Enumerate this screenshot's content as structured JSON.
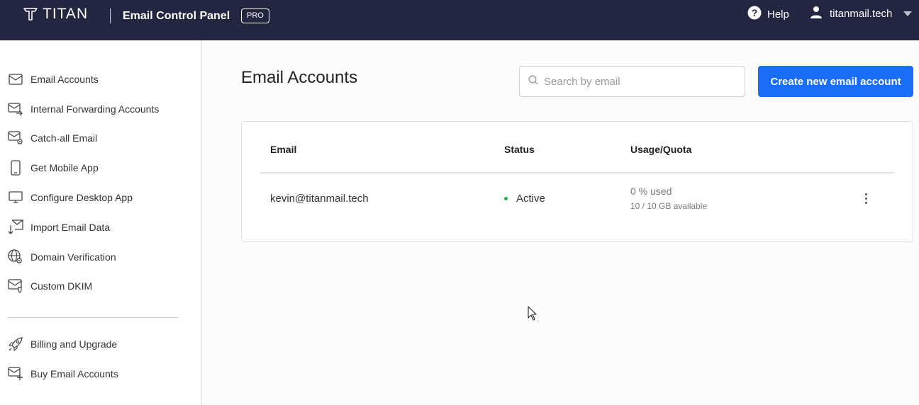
{
  "header": {
    "logo_text": "TITAN",
    "app_title": "Email Control Panel",
    "badge": "PRO",
    "help_label": "Help",
    "user_domain": "titanmail.tech"
  },
  "sidebar": {
    "items": [
      {
        "label": "Email Accounts",
        "icon": "envelope-icon"
      },
      {
        "label": "Internal Forwarding Accounts",
        "icon": "forward-mail-icon"
      },
      {
        "label": "Catch-all Email",
        "icon": "mail-gear-icon"
      },
      {
        "label": "Get Mobile App",
        "icon": "phone-icon"
      },
      {
        "label": "Configure Desktop App",
        "icon": "monitor-icon"
      },
      {
        "label": "Import Email Data",
        "icon": "import-icon"
      },
      {
        "label": "Domain Verification",
        "icon": "globe-gear-icon"
      },
      {
        "label": "Custom DKIM",
        "icon": "mail-shield-icon"
      }
    ],
    "secondary_items": [
      {
        "label": "Billing and Upgrade",
        "icon": "rocket-icon"
      },
      {
        "label": "Buy Email Accounts",
        "icon": "mail-plus-icon"
      }
    ]
  },
  "main": {
    "title": "Email Accounts",
    "search_placeholder": "Search by email",
    "create_button": "Create new email account",
    "table": {
      "columns": [
        "Email",
        "Status",
        "Usage/Quota"
      ],
      "rows": [
        {
          "email": "kevin@titanmail.tech",
          "status": "Active",
          "usage": "0 % used",
          "quota": "10 / 10 GB available"
        }
      ]
    }
  },
  "colors": {
    "topbar": "#232640",
    "accent": "#1a6ef5",
    "status_active": "#22b14c"
  }
}
